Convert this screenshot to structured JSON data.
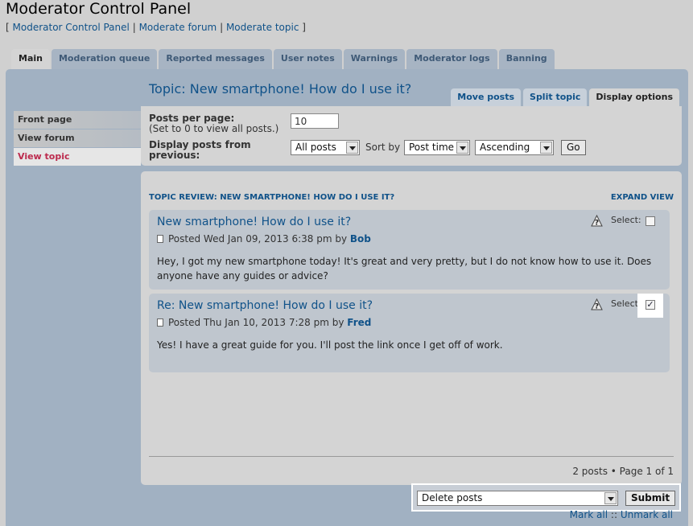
{
  "header": {
    "title": "Moderator Control Panel",
    "breadcrumb_open": "[",
    "breadcrumb_close": "]",
    "breadcrumb_sep": "|",
    "crumbs": [
      "Moderator Control Panel",
      "Moderate forum",
      "Moderate topic"
    ]
  },
  "tabs": [
    "Main",
    "Moderation queue",
    "Reported messages",
    "User notes",
    "Warnings",
    "Moderator logs",
    "Banning"
  ],
  "menu": [
    "Front page",
    "View forum",
    "View topic"
  ],
  "topic": {
    "title": "Topic: New smartphone! How do I use it?"
  },
  "subtabs": [
    "Move posts",
    "Split topic",
    "Display options"
  ],
  "options": {
    "posts_per_page_label": "Posts per page:",
    "posts_per_page_hint": "(Set to 0 to view all posts.)",
    "posts_per_page_value": "10",
    "display_from_label": "Display posts from previous:",
    "display_from_value": "All posts",
    "sort_by_label": "Sort by",
    "sort_by_value": "Post time",
    "order_value": "Ascending",
    "go_label": "Go"
  },
  "review": {
    "heading": "TOPIC REVIEW: NEW SMARTPHONE! HOW DO I USE IT?",
    "expand": "EXPAND VIEW",
    "select_label": "Select:",
    "posts": [
      {
        "title": "New smartphone! How do I use it?",
        "posted": "Posted Wed Jan 09, 2013 6:38 pm by",
        "author": "Bob",
        "body": "Hey, I got my new smartphone today! It's great and very pretty, but I do not know how to use it. Does anyone have any guides or advice?",
        "checked": false
      },
      {
        "title": "Re: New smartphone! How do I use it?",
        "posted": "Posted Thu Jan 10, 2013 7:28 pm by",
        "author": "Fred",
        "body": "Yes! I have a great guide for you. I'll post the link once I get off of work.",
        "checked": true
      }
    ],
    "pagination": "2 posts • Page 1 of 1"
  },
  "actions": {
    "action_value": "Delete posts",
    "submit_label": "Submit",
    "mark_all": "Mark all",
    "sep": "::",
    "unmark_all": "Unmark all"
  },
  "colors": {
    "link": "#105289",
    "active_menu": "#bc2a4d",
    "panel": "#a1b1c2"
  }
}
